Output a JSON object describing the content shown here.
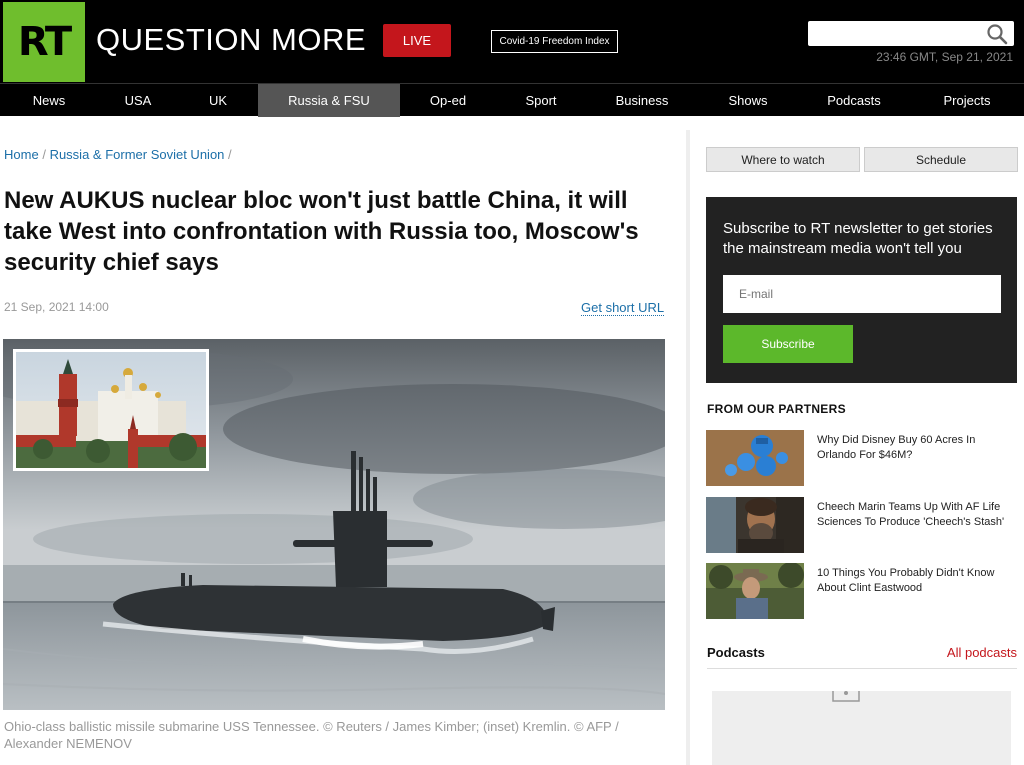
{
  "header": {
    "logo_text": "RT",
    "tagline": "QUESTION MORE",
    "live_label": "LIVE",
    "covid_label": "Covid-19 Freedom Index",
    "datetime": "23:46 GMT, Sep 21, 2021",
    "search_placeholder": ""
  },
  "nav": [
    {
      "label": "News",
      "active": false
    },
    {
      "label": "USA",
      "active": false
    },
    {
      "label": "UK",
      "active": false
    },
    {
      "label": "Russia & FSU",
      "active": true
    },
    {
      "label": "Op-ed",
      "active": false
    },
    {
      "label": "Sport",
      "active": false
    },
    {
      "label": "Business",
      "active": false
    },
    {
      "label": "Shows",
      "active": false
    },
    {
      "label": "Podcasts",
      "active": false
    },
    {
      "label": "Projects",
      "active": false
    }
  ],
  "breadcrumb": {
    "home": "Home",
    "section": "Russia & Former Soviet Union",
    "sep": "/"
  },
  "article": {
    "headline": "New AUKUS nuclear bloc won't just battle China, it will take West into confrontation with Russia too, Moscow's security chief says",
    "date": "21 Sep, 2021 14:00",
    "short_url_label": "Get short URL",
    "caption": "Ohio-class ballistic missile submarine USS Tennessee. © Reuters / James Kimber; (inset) Kremlin. © AFP / Alexander NEMENOV"
  },
  "sidebar": {
    "where_to_watch": "Where to watch",
    "schedule": "Schedule",
    "newsletter": {
      "text": "Subscribe to RT newsletter to get stories the mainstream media won't tell you",
      "email_placeholder": "E-mail",
      "button": "Subscribe"
    },
    "partners_title": "FROM OUR PARTNERS",
    "partners": [
      {
        "title": "Why Did Disney Buy 60 Acres In Orlando For $46M?"
      },
      {
        "title": "Cheech Marin Teams Up With AF Life Sciences To Produce 'Cheech's Stash'"
      },
      {
        "title": "10 Things You Probably Didn't Know About Clint Eastwood"
      }
    ],
    "podcasts_title": "Podcasts",
    "podcasts_all": "All podcasts"
  },
  "colors": {
    "brand_green": "#6fbe2d",
    "live_red": "#c4161c",
    "link_blue": "#1c6fa8",
    "subscribe_green": "#5cb82b"
  }
}
